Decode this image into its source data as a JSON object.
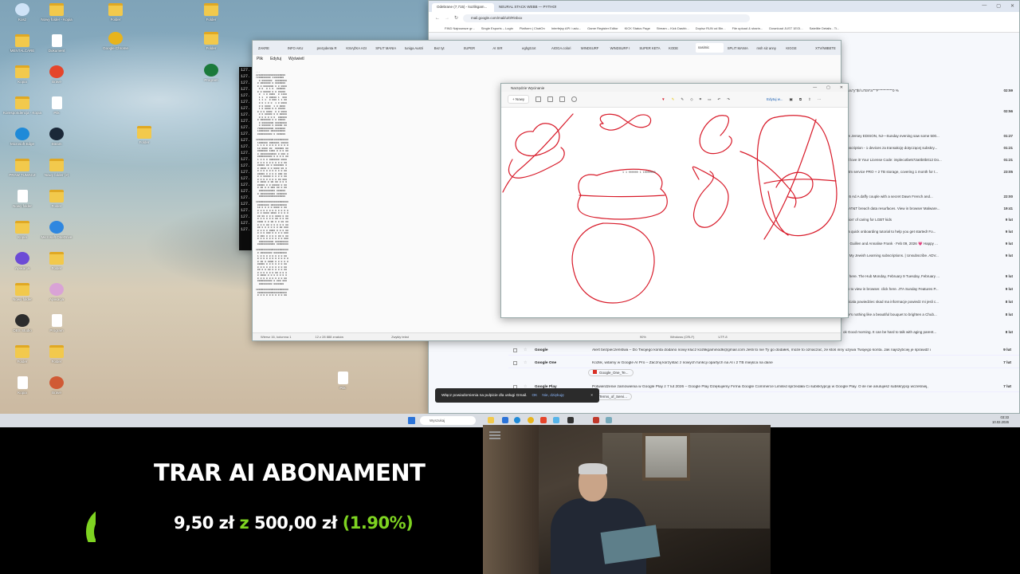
{
  "desktop": {
    "icons": [
      {
        "label": "Kosz",
        "kind": "round",
        "color": "#cfe3f7"
      },
      {
        "label": "MENTALCARE",
        "kind": "folder"
      },
      {
        "label": "Kopia",
        "kind": "folder"
      },
      {
        "label": "Korespondencja - Kopia",
        "kind": "folder"
      },
      {
        "label": "Microsoft Edge",
        "kind": "round",
        "color": "#1f8ad8"
      },
      {
        "label": "PRAW TUMACZ",
        "kind": "folder"
      },
      {
        "label": "Nowy folder",
        "kind": "doc"
      },
      {
        "label": "Kopia",
        "kind": "folder"
      },
      {
        "label": "Aplikacja",
        "kind": "round",
        "color": "#6c4bd6"
      },
      {
        "label": "Nowy folder",
        "kind": "folder"
      },
      {
        "label": "OBS Studio",
        "kind": "round",
        "color": "#2d2d2d"
      },
      {
        "label": "Folder",
        "kind": "folder"
      },
      {
        "label": "Kopia",
        "kind": "doc"
      },
      {
        "label": "Nowy folder - Kopia",
        "kind": "folder"
      },
      {
        "label": "Dokument",
        "kind": "doc"
      },
      {
        "label": "Brave",
        "kind": "round",
        "color": "#e5452b"
      },
      {
        "label": "Plik",
        "kind": "doc"
      },
      {
        "label": "Steam",
        "kind": "round",
        "color": "#1b2838"
      },
      {
        "label": "Nowy folder (2)",
        "kind": "folder"
      },
      {
        "label": "Folder",
        "kind": "folder"
      },
      {
        "label": "Microsoft OneDrive",
        "kind": "round",
        "color": "#2f87e0"
      },
      {
        "label": "Folder",
        "kind": "folder"
      },
      {
        "label": "Aplikacja",
        "kind": "round",
        "color": "#d9a3d6"
      },
      {
        "label": "Program",
        "kind": "doc"
      },
      {
        "label": "Folder",
        "kind": "folder"
      },
      {
        "label": "Brave",
        "kind": "round",
        "color": "#d05a35"
      },
      {
        "label": "Folder",
        "kind": "folder"
      },
      {
        "label": "Google Chrome",
        "kind": "round",
        "color": "#e8b41d"
      },
      {
        "label": "Folder",
        "kind": "folder"
      },
      {
        "label": "Plik",
        "kind": "doc"
      },
      {
        "label": "Folder",
        "kind": "folder"
      },
      {
        "label": "Folder",
        "kind": "folder"
      },
      {
        "label": "Program",
        "kind": "round",
        "color": "#1b7a3b"
      },
      {
        "label": "Folder",
        "kind": "folder"
      },
      {
        "label": "Plik",
        "kind": "doc"
      },
      {
        "label": "Folder",
        "kind": "folder"
      }
    ]
  },
  "chrome": {
    "tabs": [
      "Odebrane (7,715) - kozlikgam...",
      "NEURAL STACK WEBB — PYTHON..."
    ],
    "url": "mail.google.com/mail/u/0/#inbox",
    "bookmarks": [
      "FIND Najnowsze gr...",
      "Single Esports – Login",
      "Platform | ChatOn",
      "Interfejsy API i usłu...",
      "Game Register Editor",
      "KICK Status Page",
      "Stream – Kick Dashb...",
      "Dopisz RUN od Bin...",
      "File upload & sharin...",
      "Download JUST 1EGI...",
      "Satellite Details - Ti..."
    ],
    "mails": [
      {
        "sender": "Google",
        "subject": "Alert bezpieczeństwa – Do Twojego konta dodano nowy klucz kozlikgaminodk@gmail.com Jeśli to nie Ty go dodałeś, może to oznaczać, że ktoś inny używa Twojego konta. Jak najszybciej je sprawdź i",
        "date": "9 lut"
      },
      {
        "sender": "Google One",
        "subject": "Kozlik, witamy w Google AI Pro – Zacznij korzystać z nowych funkcji opartych na AI i 2 TB miejsca na dane",
        "date": "7 lut"
      },
      {
        "sender": "Google Play",
        "subject": "Potwierdzenie zamówienia w Google Play z 7 lut 2026 – Google Play Dziękujemy Firma Google Commerce Limited sprzedała Ci subskrypcję w Google Play. O ile nie anulujesz subskrypcji wcześniej,",
        "date": "7 lut"
      }
    ],
    "right_list": [
      {
        "text": "P\"\"\\ru\"y\"$!/:u\"E9\"a\"\"\"F\"\"\"\"\"\"\"\"\"\"\"0 %",
        "date": "02:59"
      },
      {
        "text": "",
        "date": "02:56"
      },
      {
        "text": "New Jersey EDISON, NJ—Sunday evening saw some 500...",
        "date": "01:27"
      },
      {
        "text": "Subscription - 1 devices za transakcję dotyczącej subskry...",
        "date": "01:21"
      },
      {
        "text": "ou'll love it! Your License Code: implecotbe572a0b0b012 Do...",
        "date": "01:21"
      },
      {
        "text": "ies/tm service PRO + 2 TB storage, covering 1 month for t...",
        "date": "23:05"
      },
      {
        "text": "",
        "date": ""
      },
      {
        "text": "2026 Ad A daffy couple with a secret Dawn French and...",
        "date": "22:00"
      },
      {
        "text": "led AT&T breach data resurfaces. View in browser Malware...",
        "date": "19:41"
      },
      {
        "text": "ession' of caring for LGBT kids",
        "date": "9 lut"
      },
      {
        "text": "ed a quick onboarding tutorial to help you get started! Fo...",
        "date": "9 lut"
      },
      {
        "text": "Joe Guillen and Annalise Frank · Feb 09, 2026 💗 Happy ...",
        "date": "9 lut"
      },
      {
        "text": "our My Jewish Learning subscriptions. | Unsubscribe. ADV...",
        "date": "9 lut"
      },
      {
        "text": "lick here. The Hub Monday, February 9 Tuesday, February ...",
        "date": "9 lut"
      },
      {
        "text": "own to view in browser. click here. JTA Sunday Features P...",
        "date": "9 lut"
      },
      {
        "text": "chcicala powiedziec skad ma informacje powiedz mi jesli c...",
        "date": "8 lut"
      },
      {
        "text": "nere's nothing like a beautiful bouquet to brighten a Chub...",
        "date": "8 lut"
      },
      {
        "text": "ok Good morning. It can be hard to talk with aging parent...",
        "date": "8 lut"
      }
    ],
    "attachment": "Google_One_Te...",
    "attachment2": "Terms_of_Servi..."
  },
  "notepad": {
    "tabs": [
      "ZAKRE",
      "INFO AKU",
      "prezydenta R",
      "KSIĄŻKA AGI",
      "SPLIT MANIA",
      "tuniga Austri",
      "Bez tyt",
      "SUPER",
      "AI SIR",
      "eghgtt.txt",
      "AIOGA.colori",
      "WINDSURF",
      "WINDSURF I",
      "SUPER KETA",
      "KODE",
      "nasimic",
      "SPLIT MANIA",
      "msh siz anny",
      "KIGGE",
      "XTV/N8BETE"
    ],
    "active_tab": "nasimic",
    "menu": [
      "Plik",
      "Edytuj",
      "Wyświetl"
    ],
    "text": "...\n22020000000200000000\n7200000000 11000000\n  0 0000000  00000000\n 0 0000000 0 0000000\n 0 0 0000000 0 0 0000\n  0 0  0 1 0  000000\n 0 0 00000 0 0 01000\n  0  1 0 0000  0 1100\n  1 1  0 00000 1  000\n  1 1 1  0 000 1 1 00\n  0 0 1 0 0  1 0 0000\n  0 0 0000  1 0 0000\n  1 0 0000 0 0 01000\n 0 0 0 0000  0 0 0000\n  0 0 00000 0 0 00000\n  0 0 0 0 0 0  000000\n 0 0000000 0 0 00000\n  0 00000000 00000000\n  0 000000 0 00000 00\n 70000000000 0000000\n 10000000 0000000000\n 0000000000 0 000000\n\n1000000000001000000000\n 1000000 0000001 00000\n 1 1 0 0 0 0 0 0 0 0 0\n 10 0000 00  000000 00\n 0000000 1000 0 0 0 00\n 0 00000000000 0 000 0\n 0000000000 0 0 0 0 00\n 1 0 0 0 0000000 0000\n 0 0 0 0 0 0 0 0 0 00\n 00000 00 0 0000000 0\n 0 0000 0 0 0000 00 0\n 0 0 0 0 0 0 0 0 0 00\n 00000 0 0 0 0 000 00\n 0 0 00000 0 0 0 0 00\n 0 0 0 0 0 0 0 00 000\n 0 0000 0 00 00 0 0 0\n 00000 0 0 00000 0 00\n 0 00 0 0 000 00 0 00\n  00000000000 000000\n 0 0000000000 0000000\n  000000000000000000\n\n1000000000010000000000\n 00000000 00000000000\n 10 0 0 0 0 0000 0 00\n 0 0 0 0 0 0 0 0 0 0 0\n 0 0 0000 0000 0 0 0 0\n 00 00 0 0 0 0000 0 00\n 0 0 0 0 0 0 00 0 0 00\n 0000 0 0 00 0 0 00 00\n 0 0 0 00 0 0 0 0 0 00\n 00 0 0 0 0 0 0 00 000\n 0 0 0 0 0000 0 0 0 00\n 0 0 0 000 0 0 0 0 000\n 0 000 0 0 0 0 00 0 00\n 0 0 0 0 0 0 0 0 0 000\n  0000000000 000000000\n 000000000000 00000000\n\n1000000000000000000000\n 0 00000000 000000000\n 1 0 0 0 0 0 0 0 0 00\n 0 0 0 0 0 0 0 0 0 0 0\n 0 00 0 0000 0 0 0 0 0\n 00000 0 0 0 0 0 0 00\n 0 0 0 0 0 0 0 0 0 00\n 00 0 0 00 0 0 0 0 00\n 0 0 0 0 0 0 00 0 0 0\n 0 0000 0 0 0 0 0 0 0\n 0 0 0 0 0 0 0 0 0 00\n 0000000000 0 000 000\n  000000000 0000000\n\n1000000000000000000000\n 00000000000000000000\n 0 0 0 0 0 0 0 0 0 00",
    "status": [
      "Wiersz 16, kolumna 1",
      "12 z 28 888 znaków",
      "Zwykły tekst",
      "90%",
      "Windows (CRLF)",
      "UTF-8"
    ]
  },
  "terminal": {
    "lines": [
      "127.",
      "127.",
      "127.",
      "127.",
      "127.",
      "127.",
      "127.",
      "127.",
      "127.",
      "127.",
      "127.",
      "127.",
      "127.",
      "127.",
      "127.",
      "127.",
      "127.",
      "127.",
      "127.",
      "127.",
      "127.",
      "127.",
      "127.",
      "127.",
      "127.",
      "127."
    ]
  },
  "paint": {
    "title": "Narzędzie Wycinanie",
    "new_label": "Nowy",
    "edit_label": "Edytuj w...",
    "stroke_color": "#d81b2a"
  },
  "toast": {
    "text": "Włącz powiadomienia na pulpicie dla usługi Gmail.",
    "ok": "OK",
    "no": "Nie, dziękuję",
    "close": "×"
  },
  "taskbar": {
    "search_placeholder": "Wyszukaj",
    "time": "03:33",
    "date": "10.02.2026"
  },
  "overlay": {
    "title": "TRAR AI ABONAMENT",
    "amount": "9,50 zł",
    "sep": "z",
    "goal": "500,00 zł",
    "percent": "(1.90%)",
    "progress": 0.019,
    "accent": "#7ed321"
  }
}
